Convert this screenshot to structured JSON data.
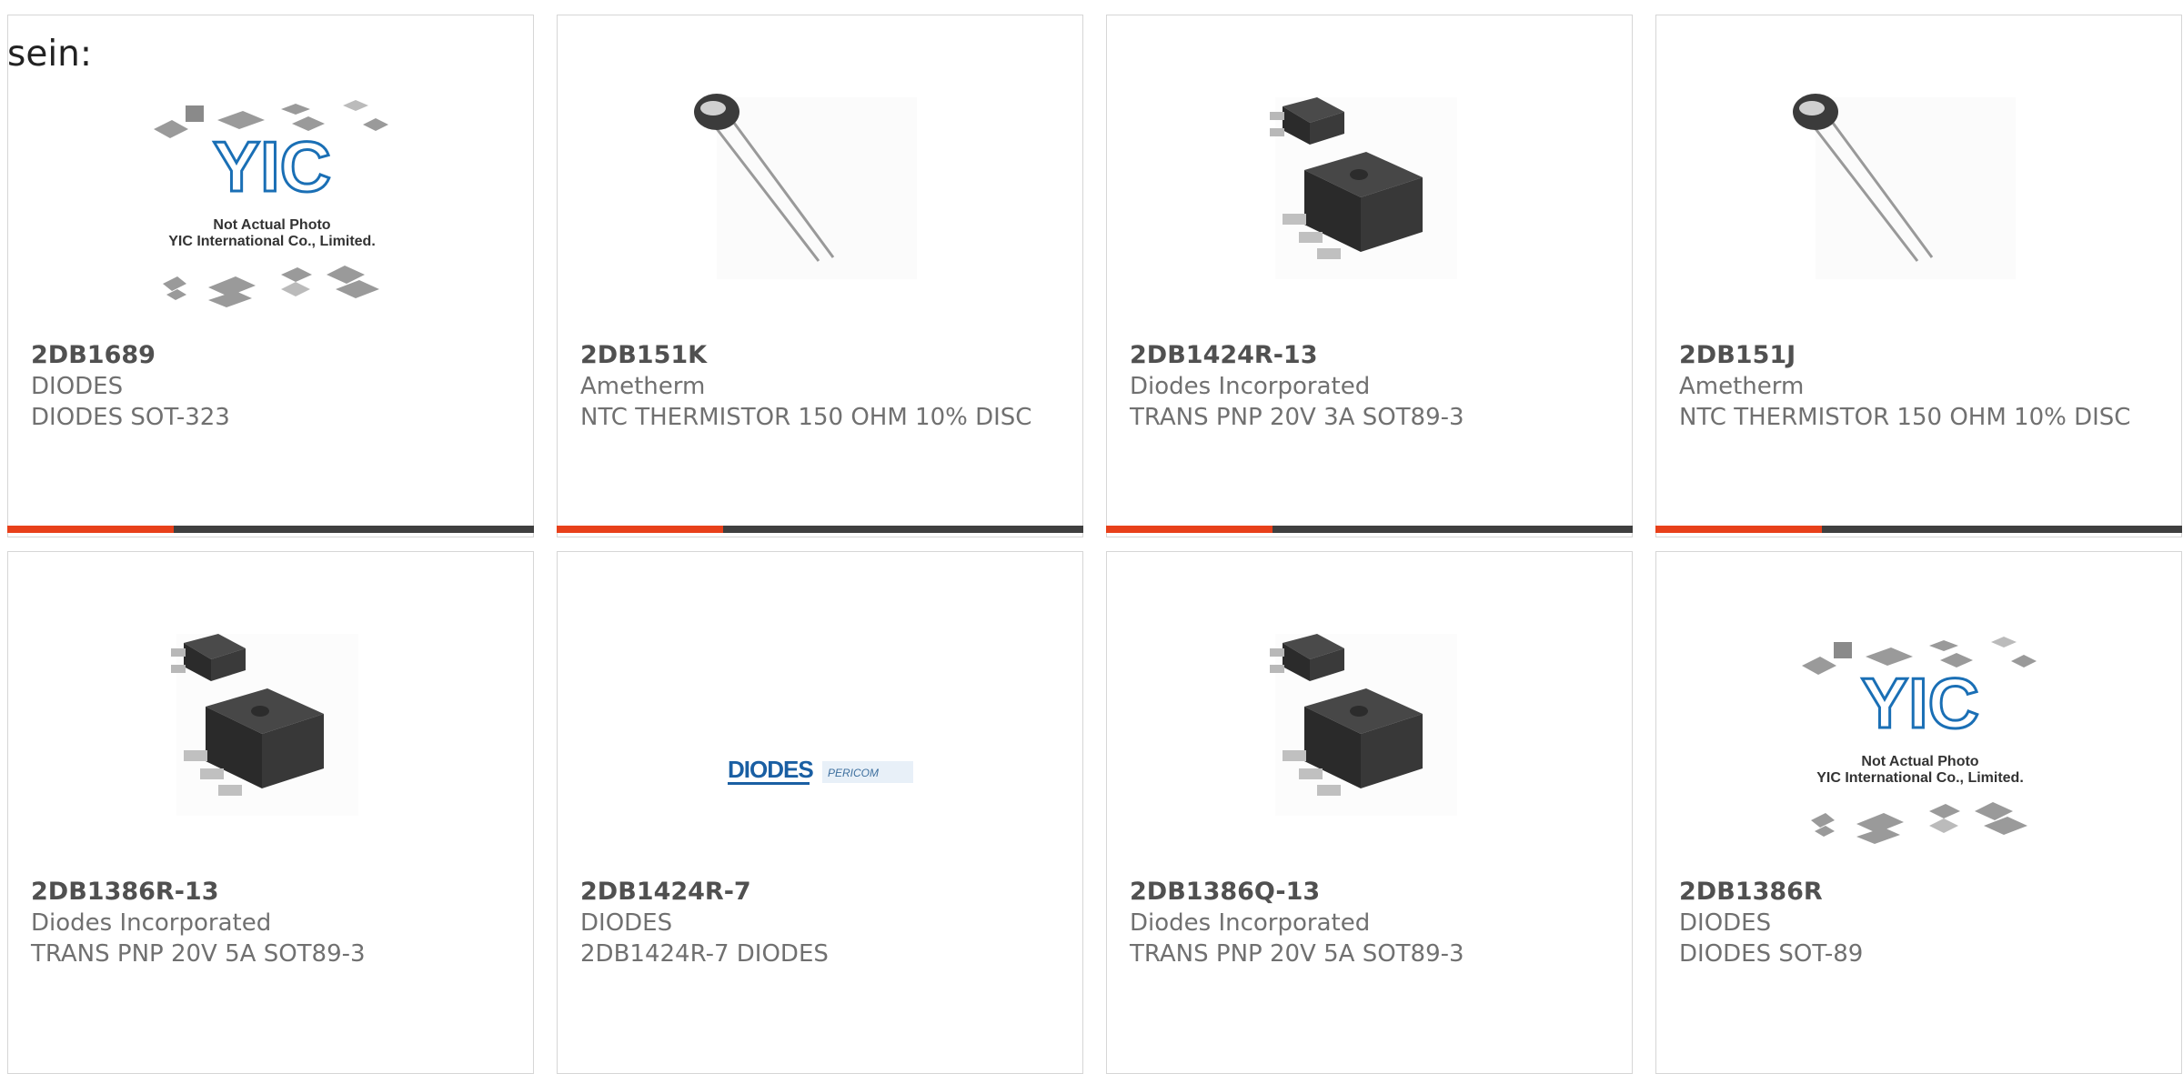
{
  "intro_text": "sein:",
  "products": [
    {
      "part": "2DB1689",
      "manufacturer": "DIODES",
      "description": "DIODES SOT-323",
      "image": "yic-placeholder"
    },
    {
      "part": "2DB151K",
      "manufacturer": "Ametherm",
      "description": "NTC THERMISTOR 150 OHM 10% DISC",
      "image": "thermistor"
    },
    {
      "part": "2DB1424R-13",
      "manufacturer": "Diodes Incorporated",
      "description": "TRANS PNP 20V 3A SOT89-3",
      "image": "sot89"
    },
    {
      "part": "2DB151J",
      "manufacturer": "Ametherm",
      "description": "NTC THERMISTOR 150 OHM 10% DISC",
      "image": "thermistor"
    },
    {
      "part": "2DB1386R-13",
      "manufacturer": "Diodes Incorporated",
      "description": "TRANS PNP 20V 5A SOT89-3",
      "image": "sot89"
    },
    {
      "part": "2DB1424R-7",
      "manufacturer": "DIODES",
      "description": "2DB1424R-7 DIODES",
      "image": "diodes-logo"
    },
    {
      "part": "2DB1386Q-13",
      "manufacturer": "Diodes Incorporated",
      "description": "TRANS PNP 20V 5A SOT89-3",
      "image": "sot89"
    },
    {
      "part": "2DB1386R",
      "manufacturer": "DIODES",
      "description": "DIODES SOT-89",
      "image": "yic-placeholder"
    }
  ],
  "placeholder": {
    "brand": "YIC",
    "line1": "Not Actual Photo",
    "line2": "YIC International Co., Limited."
  },
  "logo": {
    "diodes": "DIODES",
    "pericom": "PERICOM"
  },
  "colors": {
    "accent": "#e8401a",
    "bar": "#3f3f3f",
    "text": "#707070",
    "brand_blue": "#1a6fb5"
  }
}
